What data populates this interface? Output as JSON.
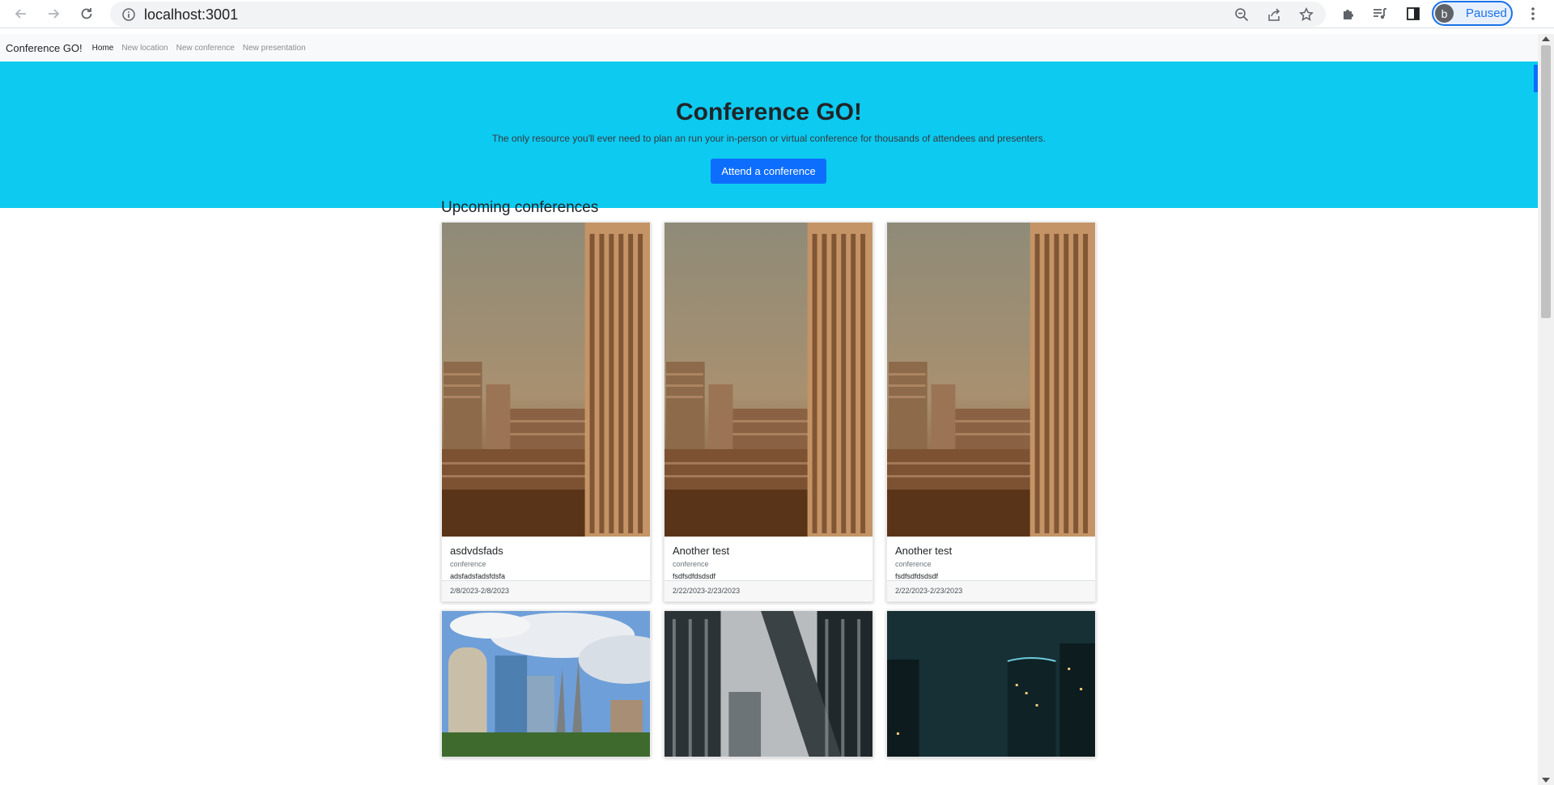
{
  "browser": {
    "url": "localhost:3001",
    "profile_initial": "b",
    "profile_status": "Paused"
  },
  "navbar": {
    "brand": "Conference GO!",
    "links": [
      "Home",
      "New location",
      "New conference",
      "New presentation"
    ],
    "active": "Home"
  },
  "hero": {
    "title": "Conference GO!",
    "subtitle": "The only resource you'll ever need to plan an run your in-person or virtual conference for thousands of attendees and presenters.",
    "cta_label": "Attend a conference",
    "bg_color": "#0dcaf0",
    "cta_color": "#0d6efd"
  },
  "main": {
    "heading": "Upcoming conferences",
    "conferences": [
      {
        "name": "asdvdsfads",
        "type": "conference",
        "description": "adsfadsfadsfdsfa",
        "dates": "2/8/2023-2/8/2023",
        "image": "sepia-highrise"
      },
      {
        "name": "Another test",
        "type": "conference",
        "description": "fsdfsdfdsdsdf",
        "dates": "2/22/2023-2/23/2023",
        "image": "sepia-highrise"
      },
      {
        "name": "Another test",
        "type": "conference",
        "description": "fsdfsdfdsdsdf",
        "dates": "2/22/2023-2/23/2023",
        "image": "sepia-highrise"
      }
    ],
    "more_cards": [
      {
        "image": "tampa-skyline"
      },
      {
        "image": "glass-towers"
      },
      {
        "image": "night-city"
      }
    ]
  }
}
